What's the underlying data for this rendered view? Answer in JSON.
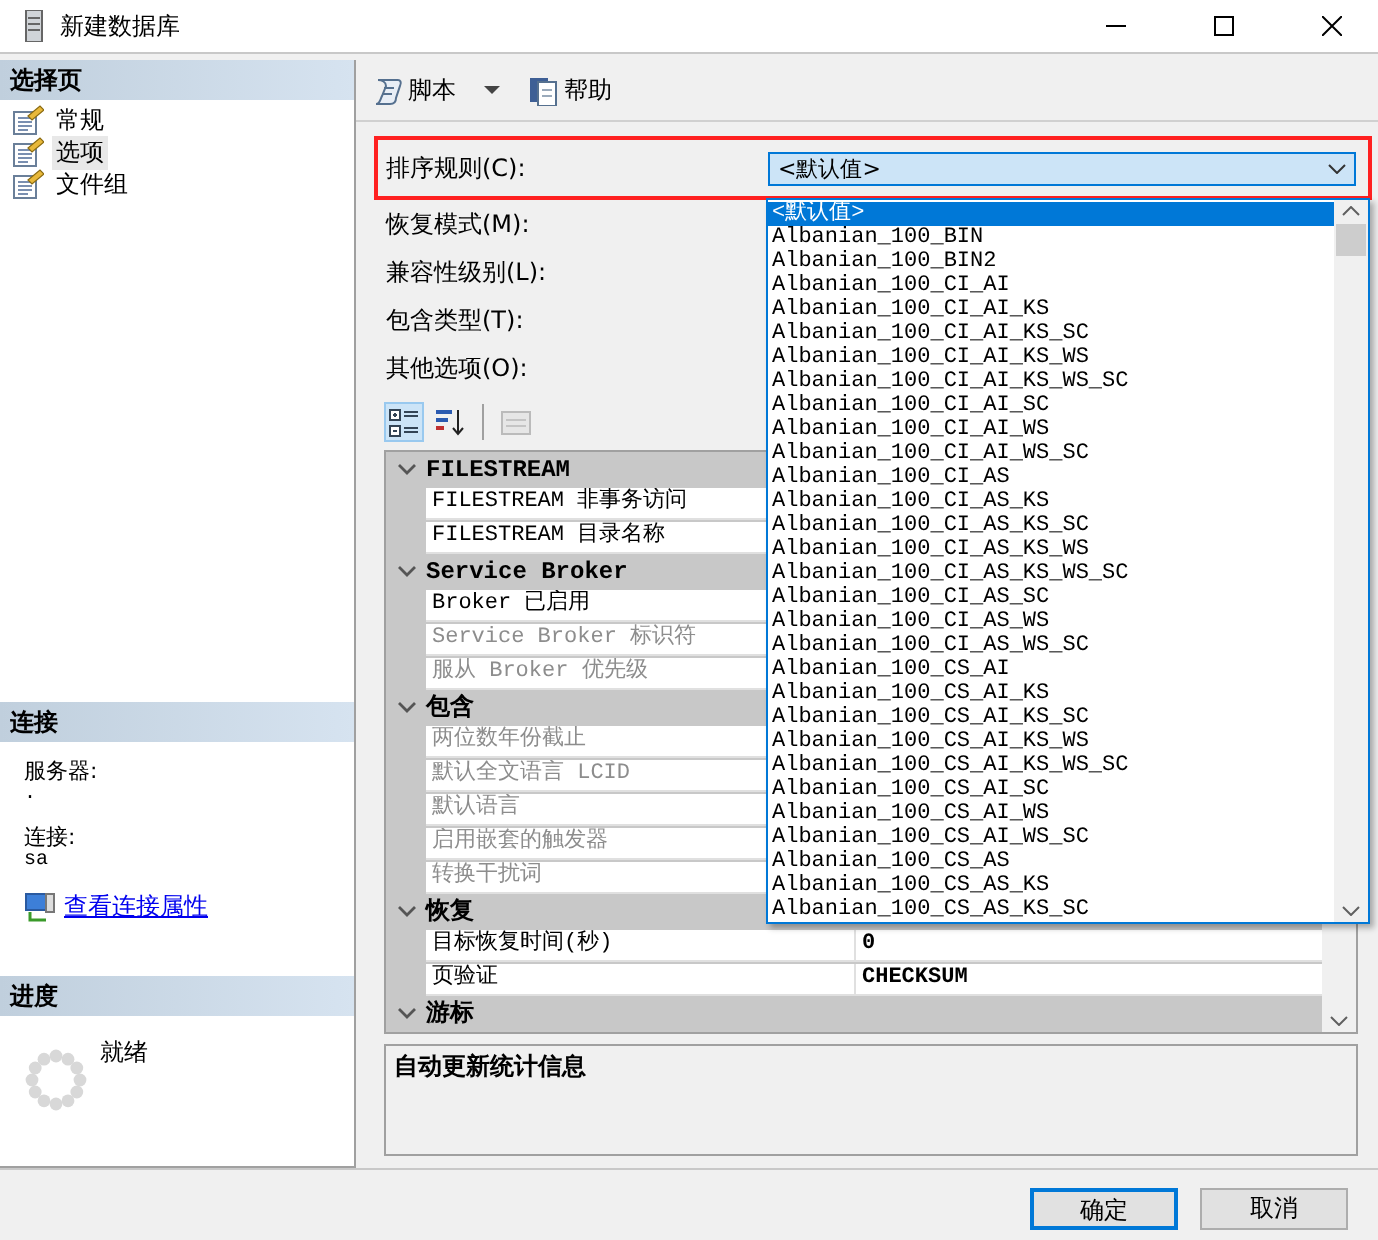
{
  "window": {
    "title": "新建数据库"
  },
  "sidebar": {
    "header": "选择页",
    "pages": [
      {
        "label": "常规",
        "selected": false
      },
      {
        "label": "选项",
        "selected": true
      },
      {
        "label": "文件组",
        "selected": false
      }
    ]
  },
  "connection": {
    "header": "连接",
    "server_label": "服务器:",
    "server": ".",
    "login_label": "连接:",
    "login": "sa",
    "link": "查看连接属性"
  },
  "progress": {
    "header": "进度",
    "status": "就绪"
  },
  "toolbar": [
    {
      "kind": "script",
      "label": "脚本"
    },
    {
      "kind": "help",
      "label": "帮助"
    }
  ],
  "collation": {
    "label": "排序规则(C):",
    "value": "<默认值>",
    "options": [
      {
        "label": "<默认值>",
        "selected": true
      },
      {
        "label": "Albanian_100_BIN",
        "selected": false
      },
      {
        "label": "Albanian_100_BIN2",
        "selected": false
      },
      {
        "label": "Albanian_100_CI_AI",
        "selected": false
      },
      {
        "label": "Albanian_100_CI_AI_KS",
        "selected": false
      },
      {
        "label": "Albanian_100_CI_AI_KS_SC",
        "selected": false
      },
      {
        "label": "Albanian_100_CI_AI_KS_WS",
        "selected": false
      },
      {
        "label": "Albanian_100_CI_AI_KS_WS_SC",
        "selected": false
      },
      {
        "label": "Albanian_100_CI_AI_SC",
        "selected": false
      },
      {
        "label": "Albanian_100_CI_AI_WS",
        "selected": false
      },
      {
        "label": "Albanian_100_CI_AI_WS_SC",
        "selected": false
      },
      {
        "label": "Albanian_100_CI_AS",
        "selected": false
      },
      {
        "label": "Albanian_100_CI_AS_KS",
        "selected": false
      },
      {
        "label": "Albanian_100_CI_AS_KS_SC",
        "selected": false
      },
      {
        "label": "Albanian_100_CI_AS_KS_WS",
        "selected": false
      },
      {
        "label": "Albanian_100_CI_AS_KS_WS_SC",
        "selected": false
      },
      {
        "label": "Albanian_100_CI_AS_SC",
        "selected": false
      },
      {
        "label": "Albanian_100_CI_AS_WS",
        "selected": false
      },
      {
        "label": "Albanian_100_CI_AS_WS_SC",
        "selected": false
      },
      {
        "label": "Albanian_100_CS_AI",
        "selected": false
      },
      {
        "label": "Albanian_100_CS_AI_KS",
        "selected": false
      },
      {
        "label": "Albanian_100_CS_AI_KS_SC",
        "selected": false
      },
      {
        "label": "Albanian_100_CS_AI_KS_WS",
        "selected": false
      },
      {
        "label": "Albanian_100_CS_AI_KS_WS_SC",
        "selected": false
      },
      {
        "label": "Albanian_100_CS_AI_SC",
        "selected": false
      },
      {
        "label": "Albanian_100_CS_AI_WS",
        "selected": false
      },
      {
        "label": "Albanian_100_CS_AI_WS_SC",
        "selected": false
      },
      {
        "label": "Albanian_100_CS_AS",
        "selected": false
      },
      {
        "label": "Albanian_100_CS_AS_KS",
        "selected": false
      },
      {
        "label": "Albanian_100_CS_AS_KS_SC",
        "selected": false
      }
    ]
  },
  "fields": [
    "恢复模式(M):",
    "兼容性级别(L):",
    "包含类型(T):",
    "其他选项(O):"
  ],
  "grid_buttons": [
    {
      "kind": "categorized",
      "selected": true,
      "disabled": false
    },
    {
      "kind": "alphabetical",
      "selected": false,
      "disabled": false
    },
    {
      "kind": "pages",
      "selected": false,
      "disabled": true
    }
  ],
  "property_grid": [
    {
      "name": "FILESTREAM",
      "expanded": true,
      "rows": [
        {
          "name": "FILESTREAM 非事务访问",
          "disabled": false
        },
        {
          "name": "FILESTREAM 目录名称",
          "disabled": false
        }
      ]
    },
    {
      "name": "Service Broker",
      "expanded": true,
      "rows": [
        {
          "name": "Broker 已启用",
          "disabled": false
        },
        {
          "name": "Service Broker 标识符",
          "disabled": true
        },
        {
          "name": "服从 Broker 优先级",
          "disabled": true
        }
      ]
    },
    {
      "name": "包含",
      "expanded": true,
      "rows": [
        {
          "name": "两位数年份截止",
          "disabled": true
        },
        {
          "name": "默认全文语言 LCID",
          "disabled": true
        },
        {
          "name": "默认语言",
          "disabled": true
        },
        {
          "name": "启用嵌套的触发器",
          "disabled": true
        },
        {
          "name": "转换干扰词",
          "disabled": true
        }
      ]
    },
    {
      "name": "恢复",
      "expanded": true,
      "rows": [
        {
          "name": "目标恢复时间(秒)",
          "value": "0",
          "disabled": false
        },
        {
          "name": "页验证",
          "value": "CHECKSUM",
          "disabled": false
        }
      ]
    },
    {
      "name": "游标",
      "expanded": true
    }
  ],
  "description": {
    "title": "自动更新统计信息"
  },
  "buttons": [
    {
      "label": "确定",
      "default": true
    },
    {
      "label": "取消",
      "default": false
    }
  ]
}
